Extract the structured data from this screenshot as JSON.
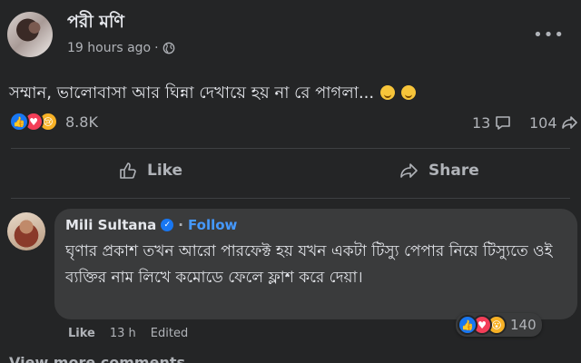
{
  "post": {
    "author": "পরী মণি",
    "time": "19 hours ago",
    "privacy_separator": "·",
    "more_label": "•••",
    "text": "সম্মান, ভালোবাসা আর ঘিন্না দেখায়ে হয় না রে পাগলা...",
    "reaction_count": "8.8K",
    "comment_count": "13",
    "share_count": "104",
    "actions": {
      "like": "Like",
      "share": "Share"
    }
  },
  "comment": {
    "author": "Mili Sultana",
    "separator": "·",
    "follow": "Follow",
    "text": "ঘৃণার প্রকাশ তখন আরো পারফেক্ট হয় যখন একটা টিস্যু পেপার নিয়ে টিস্যুতে ওই ব্যক্তির নাম লিখে কমোডে ফেলে ফ্লাশ করে দেয়া।",
    "reaction_count": "140",
    "actions": {
      "like": "Like",
      "time": "13 h",
      "edited": "Edited"
    }
  },
  "footer": {
    "view_more": "View more comments"
  },
  "colors": {
    "background": "#242526",
    "bubble": "#3a3b3c",
    "accent": "#1877f2",
    "love": "#f33e58",
    "haha": "#f7b125"
  }
}
